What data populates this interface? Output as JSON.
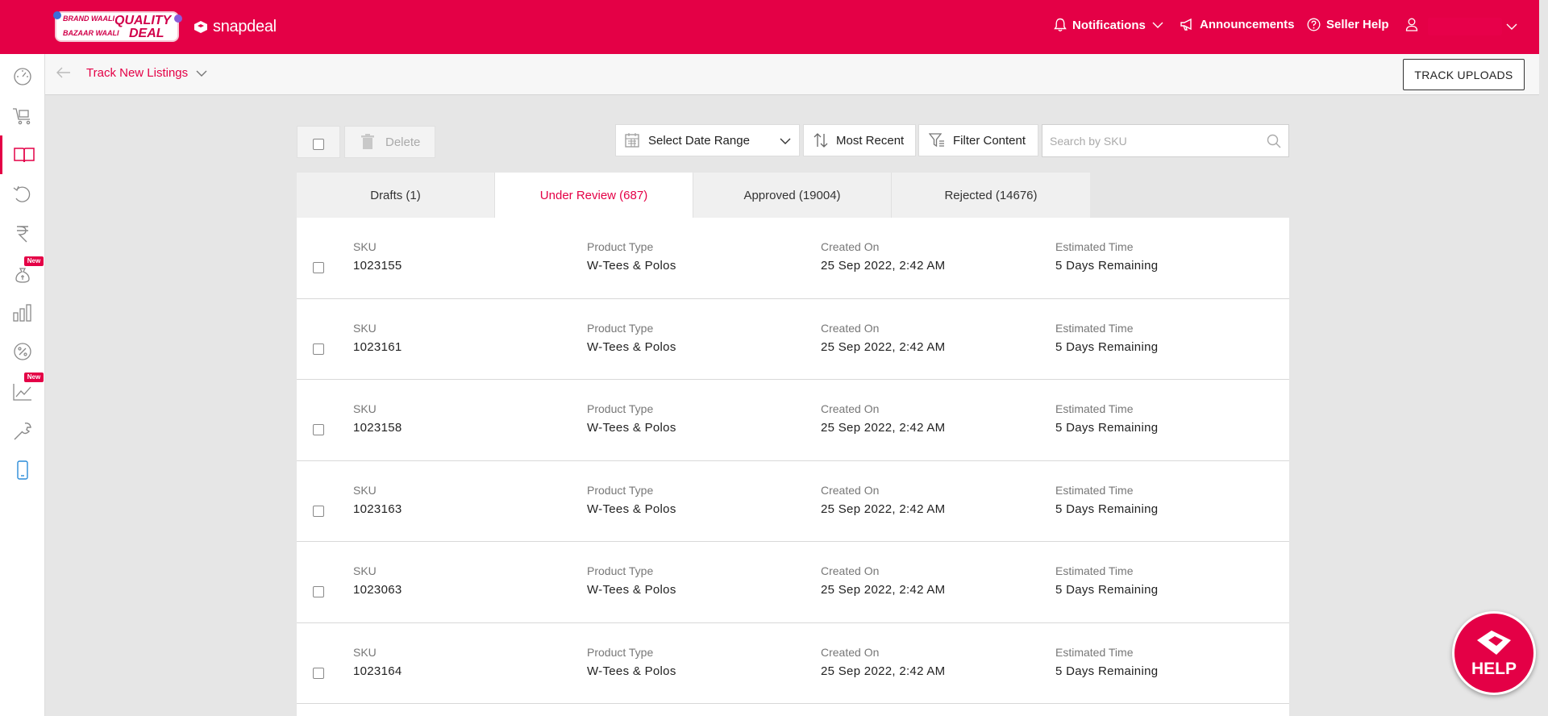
{
  "header": {
    "promo": {
      "line1": "BRAND WAALI",
      "line2": "QUALITY",
      "line3": "BAZAAR WAALI",
      "line4": "DEAL"
    },
    "logo_text": "snapdeal",
    "notifications_label": "Notifications",
    "announcements_label": "Announcements",
    "seller_help_label": "Seller Help",
    "brand_color": "#e40046"
  },
  "sidebar": {
    "items": [
      {
        "icon": "dashboard-icon"
      },
      {
        "icon": "orders-cart-icon"
      },
      {
        "icon": "catalog-book-icon",
        "active": true
      },
      {
        "icon": "returns-icon"
      },
      {
        "icon": "payments-rupee-icon"
      },
      {
        "icon": "money-bag-icon",
        "badge": "New"
      },
      {
        "icon": "bar-chart-icon"
      },
      {
        "icon": "discount-icon"
      },
      {
        "icon": "trend-line-icon",
        "badge": "New"
      },
      {
        "icon": "tools-wrench-icon"
      },
      {
        "icon": "mobile-phone-icon"
      }
    ]
  },
  "subheader": {
    "breadcrumb": "Track New Listings",
    "track_uploads_label": "TRACK UPLOADS"
  },
  "toolbar": {
    "delete_label": "Delete",
    "date_range_label": "Select Date Range",
    "sort_label": "Most Recent",
    "filter_label": "Filter Content",
    "search_placeholder": "Search by SKU"
  },
  "tabs": [
    {
      "label": "Drafts (1)",
      "active": false
    },
    {
      "label": "Under Review (687)",
      "active": true
    },
    {
      "label": "Approved (19004)",
      "active": false
    },
    {
      "label": "Rejected (14676)",
      "active": false
    }
  ],
  "columns": {
    "sku": "SKU",
    "product_type": "Product Type",
    "created_on": "Created On",
    "estimated_time": "Estimated Time"
  },
  "rows": [
    {
      "sku": "1023155",
      "product_type": "W-Tees & Polos",
      "created_on": "25 Sep 2022, 2:42 AM",
      "estimated_time": "5 Days Remaining"
    },
    {
      "sku": "1023161",
      "product_type": "W-Tees & Polos",
      "created_on": "25 Sep 2022, 2:42 AM",
      "estimated_time": "5 Days Remaining"
    },
    {
      "sku": "1023158",
      "product_type": "W-Tees & Polos",
      "created_on": "25 Sep 2022, 2:42 AM",
      "estimated_time": "5 Days Remaining"
    },
    {
      "sku": "1023163",
      "product_type": "W-Tees & Polos",
      "created_on": "25 Sep 2022, 2:42 AM",
      "estimated_time": "5 Days Remaining"
    },
    {
      "sku": "1023063",
      "product_type": "W-Tees & Polos",
      "created_on": "25 Sep 2022, 2:42 AM",
      "estimated_time": "5 Days Remaining"
    },
    {
      "sku": "1023164",
      "product_type": "W-Tees & Polos",
      "created_on": "25 Sep 2022, 2:42 AM",
      "estimated_time": "5 Days Remaining"
    }
  ],
  "help_label": "HELP"
}
